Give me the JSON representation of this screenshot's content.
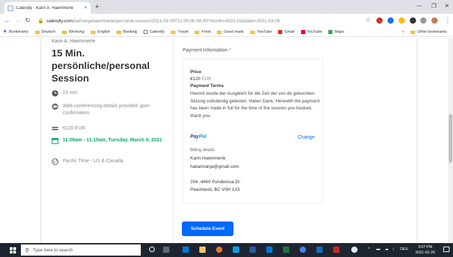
{
  "browser": {
    "tab_title": "Calendly - Karin A. Haemmerle",
    "tab_close": "×",
    "new_tab": "+",
    "url_host": "calendly.com",
    "url_path": "/karinanjahaemmerle/personal-session/2021-03-09T11:00:00-08:00?month=2021-03&date=2021-03-09",
    "bookmarks": [
      {
        "label": "Bookmarks",
        "kind": "star",
        "color": "#1a73e8"
      },
      {
        "label": "Deutsch",
        "kind": "folder"
      },
      {
        "label": "Werbung",
        "kind": "folder"
      },
      {
        "label": "English",
        "kind": "folder"
      },
      {
        "label": "Banking",
        "kind": "folder"
      },
      {
        "label": "Calendly",
        "kind": "page",
        "color": "#ffffff"
      },
      {
        "label": "Travel",
        "kind": "folder"
      },
      {
        "label": "Food",
        "kind": "folder"
      },
      {
        "label": "Good reads",
        "kind": "folder"
      },
      {
        "label": "YouTube",
        "kind": "folder"
      },
      {
        "label": "Gmail",
        "kind": "gmail",
        "color": "#d93025"
      },
      {
        "label": "YouTube",
        "kind": "youtube",
        "color": "#ff0000"
      },
      {
        "label": "Maps",
        "kind": "maps",
        "color": "#34a853"
      }
    ],
    "more_bookmarks": "»",
    "other_bookmarks": "Other bookmarks"
  },
  "event": {
    "host_name": "Karin A. Haemmerle",
    "title": "15 Min. persönliche/personal Session",
    "duration": "15 min",
    "conferencing": "Web conferencing details provided upon confirmation.",
    "price": "€120 EUR",
    "datetime": "11:00am - 11:15am, Tuesday, March 9, 2021",
    "timezone": "Pacific Time - US & Canada"
  },
  "payment": {
    "section_label": "Payment Information",
    "required_mark": "*",
    "price_heading": "Price",
    "price_value": "€120",
    "price_currency": "EUR",
    "terms_heading": "Payment Terms",
    "terms_text": "Hiermit wurde der Ausgleich für die Zeit der von dir gebuchten Sitzung vollständig geleistet. Vielen Dank. Herewith the payment has been made in full for the time of the session you booked, thank you.",
    "paypal_a": "Pay",
    "paypal_b": "Pal",
    "change_label": "Change",
    "billing_heading": "Billing details",
    "billing_name": "Karin Haemmerle",
    "billing_email": "hakarinanja@gmail.com",
    "address_line1": "204 -4460 Ponderosa Dr.",
    "address_line2": "Peachland, BC V0H 1X5"
  },
  "actions": {
    "schedule_label": "Schedule Event"
  },
  "taskbar": {
    "search_placeholder": "Type here to search",
    "language": "DEU",
    "time": "3:07 PM",
    "date": "2021-02-25"
  },
  "colors": {
    "accent": "#0069ff",
    "green": "#0da678",
    "taskbar": "#1f2530"
  }
}
